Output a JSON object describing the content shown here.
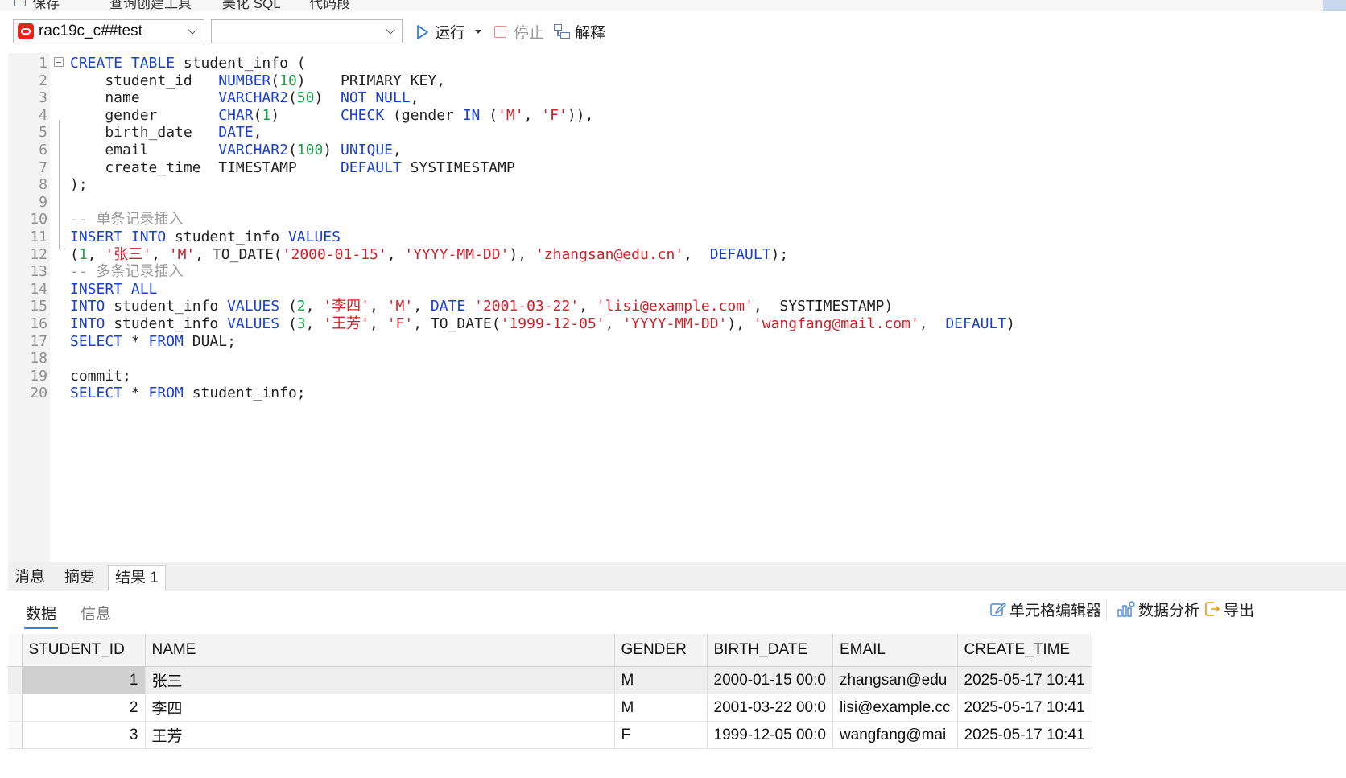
{
  "top_toolbar": {
    "items": [
      "保存",
      "查询创建工具",
      "美化 SQL",
      "代码段"
    ]
  },
  "toolbar": {
    "connection": "rac19c_c##test",
    "database": "",
    "run_label": "运行",
    "stop_label": "停止",
    "explain_label": "解释"
  },
  "editor": {
    "lines": [
      {
        "no": "1"
      },
      {
        "no": "2"
      },
      {
        "no": "3"
      },
      {
        "no": "4"
      },
      {
        "no": "5"
      },
      {
        "no": "6"
      },
      {
        "no": "7"
      },
      {
        "no": "8"
      },
      {
        "no": "9"
      },
      {
        "no": "10"
      },
      {
        "no": "11"
      },
      {
        "no": "12"
      },
      {
        "no": "13"
      },
      {
        "no": "14"
      },
      {
        "no": "15"
      },
      {
        "no": "16"
      },
      {
        "no": "17"
      },
      {
        "no": "18"
      },
      {
        "no": "19"
      },
      {
        "no": "20"
      }
    ],
    "code": [
      [
        [
          "k",
          "CREATE TABLE"
        ],
        [
          "p",
          " student_info ("
        ]
      ],
      [
        [
          "p",
          "    student_id   "
        ],
        [
          "k",
          "NUMBER"
        ],
        [
          "p",
          "("
        ],
        [
          "n",
          "10"
        ],
        [
          "p",
          ")    PRIMARY KEY,"
        ]
      ],
      [
        [
          "p",
          "    name         "
        ],
        [
          "k",
          "VARCHAR2"
        ],
        [
          "p",
          "("
        ],
        [
          "n",
          "50"
        ],
        [
          "p",
          ")  "
        ],
        [
          "k",
          "NOT NULL"
        ],
        [
          "p",
          ","
        ]
      ],
      [
        [
          "p",
          "    gender       "
        ],
        [
          "k",
          "CHAR"
        ],
        [
          "p",
          "("
        ],
        [
          "n",
          "1"
        ],
        [
          "p",
          ")       "
        ],
        [
          "k",
          "CHECK"
        ],
        [
          "p",
          " (gender "
        ],
        [
          "k",
          "IN"
        ],
        [
          "p",
          " ("
        ],
        [
          "s",
          "'M'"
        ],
        [
          "p",
          ", "
        ],
        [
          "s",
          "'F'"
        ],
        [
          "p",
          ")),"
        ]
      ],
      [
        [
          "p",
          "    birth_date   "
        ],
        [
          "k",
          "DATE"
        ],
        [
          "p",
          ","
        ]
      ],
      [
        [
          "p",
          "    email        "
        ],
        [
          "k",
          "VARCHAR2"
        ],
        [
          "p",
          "("
        ],
        [
          "n",
          "100"
        ],
        [
          "p",
          ") "
        ],
        [
          "k",
          "UNIQUE"
        ],
        [
          "p",
          ","
        ]
      ],
      [
        [
          "p",
          "    create_time  TIMESTAMP     "
        ],
        [
          "k",
          "DEFAULT"
        ],
        [
          "p",
          " SYSTIMESTAMP"
        ]
      ],
      [
        [
          "p",
          ");"
        ]
      ],
      [],
      [
        [
          "c",
          "-- 单条记录插入"
        ]
      ],
      [
        [
          "k",
          "INSERT INTO"
        ],
        [
          "p",
          " student_info "
        ],
        [
          "k",
          "VALUES"
        ]
      ],
      [
        [
          "p",
          "("
        ],
        [
          "n",
          "1"
        ],
        [
          "p",
          ", "
        ],
        [
          "s",
          "'张三'"
        ],
        [
          "p",
          ", "
        ],
        [
          "s",
          "'M'"
        ],
        [
          "p",
          ", TO_DATE("
        ],
        [
          "s",
          "'2000-01-15'"
        ],
        [
          "p",
          ", "
        ],
        [
          "s",
          "'YYYY-MM-DD'"
        ],
        [
          "p",
          "), "
        ],
        [
          "s",
          "'zhangsan@edu.cn'"
        ],
        [
          "p",
          ",  "
        ],
        [
          "k",
          "DEFAULT"
        ],
        [
          "p",
          ");"
        ]
      ],
      [
        [
          "c",
          "-- 多条记录插入"
        ]
      ],
      [
        [
          "k",
          "INSERT ALL"
        ]
      ],
      [
        [
          "k",
          "INTO"
        ],
        [
          "p",
          " student_info "
        ],
        [
          "k",
          "VALUES"
        ],
        [
          "p",
          " ("
        ],
        [
          "n",
          "2"
        ],
        [
          "p",
          ", "
        ],
        [
          "s",
          "'李四'"
        ],
        [
          "p",
          ", "
        ],
        [
          "s",
          "'M'"
        ],
        [
          "p",
          ", "
        ],
        [
          "k",
          "DATE"
        ],
        [
          "p",
          " "
        ],
        [
          "s",
          "'2001-03-22'"
        ],
        [
          "p",
          ", "
        ],
        [
          "s",
          "'lisi@example.com'"
        ],
        [
          "p",
          ",  SYSTIMESTAMP)"
        ]
      ],
      [
        [
          "k",
          "INTO"
        ],
        [
          "p",
          " student_info "
        ],
        [
          "k",
          "VALUES"
        ],
        [
          "p",
          " ("
        ],
        [
          "n",
          "3"
        ],
        [
          "p",
          ", "
        ],
        [
          "s",
          "'王芳'"
        ],
        [
          "p",
          ", "
        ],
        [
          "s",
          "'F'"
        ],
        [
          "p",
          ", TO_DATE("
        ],
        [
          "s",
          "'1999-12-05'"
        ],
        [
          "p",
          ", "
        ],
        [
          "s",
          "'YYYY-MM-DD'"
        ],
        [
          "p",
          "), "
        ],
        [
          "s",
          "'wangfang@mail.com'"
        ],
        [
          "p",
          ",  "
        ],
        [
          "k",
          "DEFAULT"
        ],
        [
          "p",
          ")"
        ]
      ],
      [
        [
          "k",
          "SELECT"
        ],
        [
          "p",
          " * "
        ],
        [
          "k",
          "FROM"
        ],
        [
          "p",
          " DUAL;"
        ]
      ],
      [],
      [
        [
          "p",
          "commit;"
        ]
      ],
      [
        [
          "k",
          "SELECT"
        ],
        [
          "p",
          " * "
        ],
        [
          "k",
          "FROM"
        ],
        [
          "p",
          " student_info;"
        ]
      ]
    ]
  },
  "result_tabs": [
    "消息",
    "摘要",
    "结果 1"
  ],
  "sub_tabs": [
    "数据",
    "信息"
  ],
  "result_tools": {
    "cell_editor": "单元格编辑器",
    "data_analysis": "数据分析",
    "export": "导出"
  },
  "grid": {
    "columns": [
      "STUDENT_ID",
      "NAME",
      "GENDER",
      "BIRTH_DATE",
      "EMAIL",
      "CREATE_TIME"
    ],
    "rows": [
      [
        "1",
        "张三",
        "M",
        "2000-01-15 00:0",
        "zhangsan@edu",
        "2025-05-17 10:41"
      ],
      [
        "2",
        "李四",
        "M",
        "2001-03-22 00:0",
        "lisi@example.cc",
        "2025-05-17 10:41"
      ],
      [
        "3",
        "王芳",
        "F",
        "1999-12-05 00:0",
        "wangfang@mai",
        "2025-05-17 10:41"
      ]
    ]
  },
  "colors": {
    "keyword": "#1a3fd6",
    "string": "#d2202a",
    "number": "#17a34a",
    "comment": "#9a9a9a",
    "accent": "#2e86de"
  }
}
